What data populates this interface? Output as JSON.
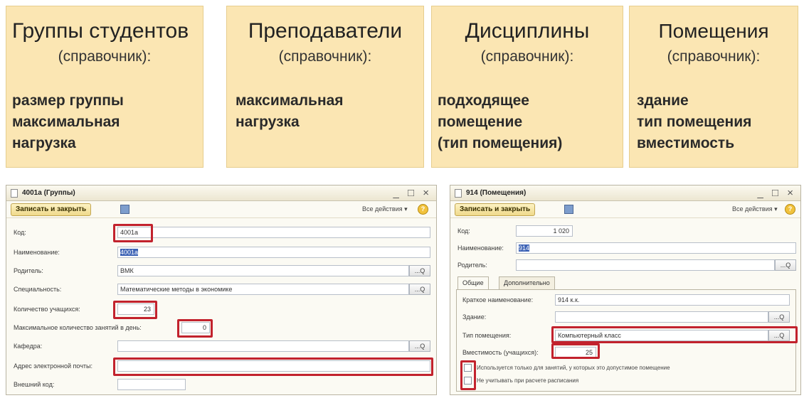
{
  "cards": [
    {
      "title": "Группы студентов",
      "subtitle": "(справочник):",
      "lines": [
        "размер группы",
        "максимальная",
        "нагрузка"
      ]
    },
    {
      "title": "Преподаватели",
      "subtitle": "(справочник):",
      "lines": [
        "максимальная",
        "нагрузка"
      ]
    },
    {
      "title": "Дисциплины",
      "subtitle": "(справочник):",
      "lines": [
        "подходящее",
        "помещение",
        "(тип помещения)"
      ]
    },
    {
      "title": "Помещения",
      "subtitle": "(справочник):",
      "lines": [
        "здание",
        "тип помещения",
        "вместимость"
      ]
    }
  ],
  "window_groups": {
    "title": "4001а (Группы)",
    "window_buttons": "_ □ ×",
    "save_close": "Записать и закрыть",
    "all_actions": "Все действия ▾",
    "help": "?",
    "pick_icon": "...Q",
    "fields": {
      "code": {
        "label": "Код:",
        "value": "4001а"
      },
      "name": {
        "label": "Наименование:",
        "value": "4001а"
      },
      "parent": {
        "label": "Родитель:",
        "value": "ВМК"
      },
      "specialty": {
        "label": "Специальность:",
        "value": "Математические методы в экономике"
      },
      "students": {
        "label": "Количество учащихся:",
        "value": "23"
      },
      "max_lessons": {
        "label": "Максимальное количество занятий в день:",
        "value": "0"
      },
      "department": {
        "label": "Кафедра:",
        "value": ""
      },
      "email": {
        "label": "Адрес электронной почты:",
        "value": ""
      },
      "external_code": {
        "label": "Внешний код:",
        "value": ""
      }
    }
  },
  "window_rooms": {
    "title": "914 (Помещения)",
    "window_buttons": "_ □ ×",
    "save_close": "Записать и закрыть",
    "all_actions": "Все действия ▾",
    "help": "?",
    "pick_icon": "...Q",
    "tabs": [
      "Общие",
      "Дополнительно"
    ],
    "fields": {
      "code": {
        "label": "Код:",
        "value": "1 020"
      },
      "name": {
        "label": "Наименование:",
        "value": "914"
      },
      "parent": {
        "label": "Родитель:",
        "value": ""
      },
      "short_name": {
        "label": "Краткое наименование:",
        "value": "914 к.к."
      },
      "building": {
        "label": "Здание:",
        "value": ""
      },
      "room_type": {
        "label": "Тип помещения:",
        "value": "Компьютерный класс"
      },
      "capacity": {
        "label": "Вместимость (учащихся):",
        "value": "25"
      }
    },
    "checkboxes": [
      "Используется только для занятий, у которых это допустимое помещение",
      "Не учитывать при расчете расписания"
    ]
  },
  "colors": {
    "card_bg": "#fbe6b3",
    "highlight": "#c2222d",
    "selection": "#3d63b5"
  }
}
